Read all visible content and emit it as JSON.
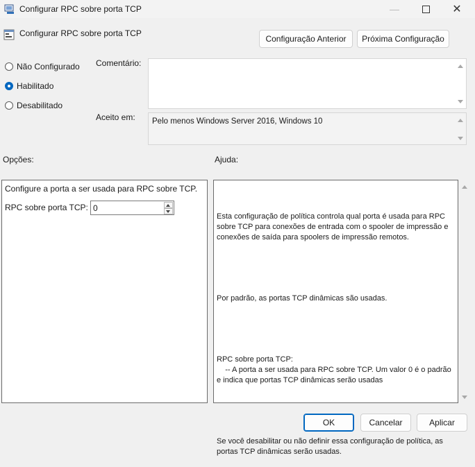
{
  "window": {
    "title": "Configurar RPC sobre porta TCP",
    "minimize_icon": "minimize-icon",
    "maximize_icon": "maximize-icon",
    "close_icon": "close-icon"
  },
  "header": {
    "title": "Configurar RPC sobre porta TCP",
    "prev_button": "Configuração Anterior",
    "next_button": "Próxima Configuração"
  },
  "state": {
    "options": [
      {
        "label": "Não Configurado",
        "checked": false
      },
      {
        "label": "Habilitado",
        "checked": true
      },
      {
        "label": "Desabilitado",
        "checked": false
      }
    ]
  },
  "comment": {
    "label": "Comentário:",
    "value": ""
  },
  "supported": {
    "label": "Aceito em:",
    "value": "Pelo menos Windows Server 2016, Windows 10"
  },
  "options_section": {
    "label": "Opções:",
    "description": "Configure a porta a ser usada para RPC sobre TCP.",
    "port_label": "RPC sobre porta TCP:",
    "port_value": "0"
  },
  "help_section": {
    "label": "Ajuda:",
    "paragraphs": [
      "Esta configuração de política controla qual porta é usada para RPC sobre TCP para conexões de entrada com o spooler de impressão e conexões de saída para spoolers de impressão remotos.",
      "Por padrão, as portas TCP dinâmicas são usadas.",
      "RPC sobre porta TCP:\n    -- A porta a ser usada para RPC sobre TCP. Um valor 0 é o padrão e indica que portas TCP dinâmicas serão usadas",
      "Se você desabilitar ou não definir essa configuração de política, as portas TCP dinâmicas serão usadas."
    ]
  },
  "footer": {
    "ok": "OK",
    "cancel": "Cancelar",
    "apply": "Aplicar"
  },
  "colors": {
    "accent": "#0067c0",
    "window_bg": "#f0f0f0"
  }
}
